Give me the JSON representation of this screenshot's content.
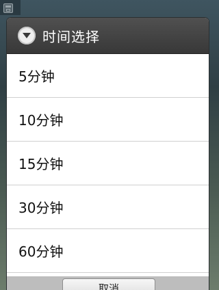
{
  "dialog": {
    "title": "时间选择",
    "title_icon": "dropdown-circle-icon",
    "options": [
      {
        "label": "5分钟"
      },
      {
        "label": "10分钟"
      },
      {
        "label": "15分钟"
      },
      {
        "label": "30分钟"
      },
      {
        "label": "60分钟"
      }
    ],
    "cancel_label": "取消"
  },
  "background": {
    "icon": "save-icon"
  }
}
